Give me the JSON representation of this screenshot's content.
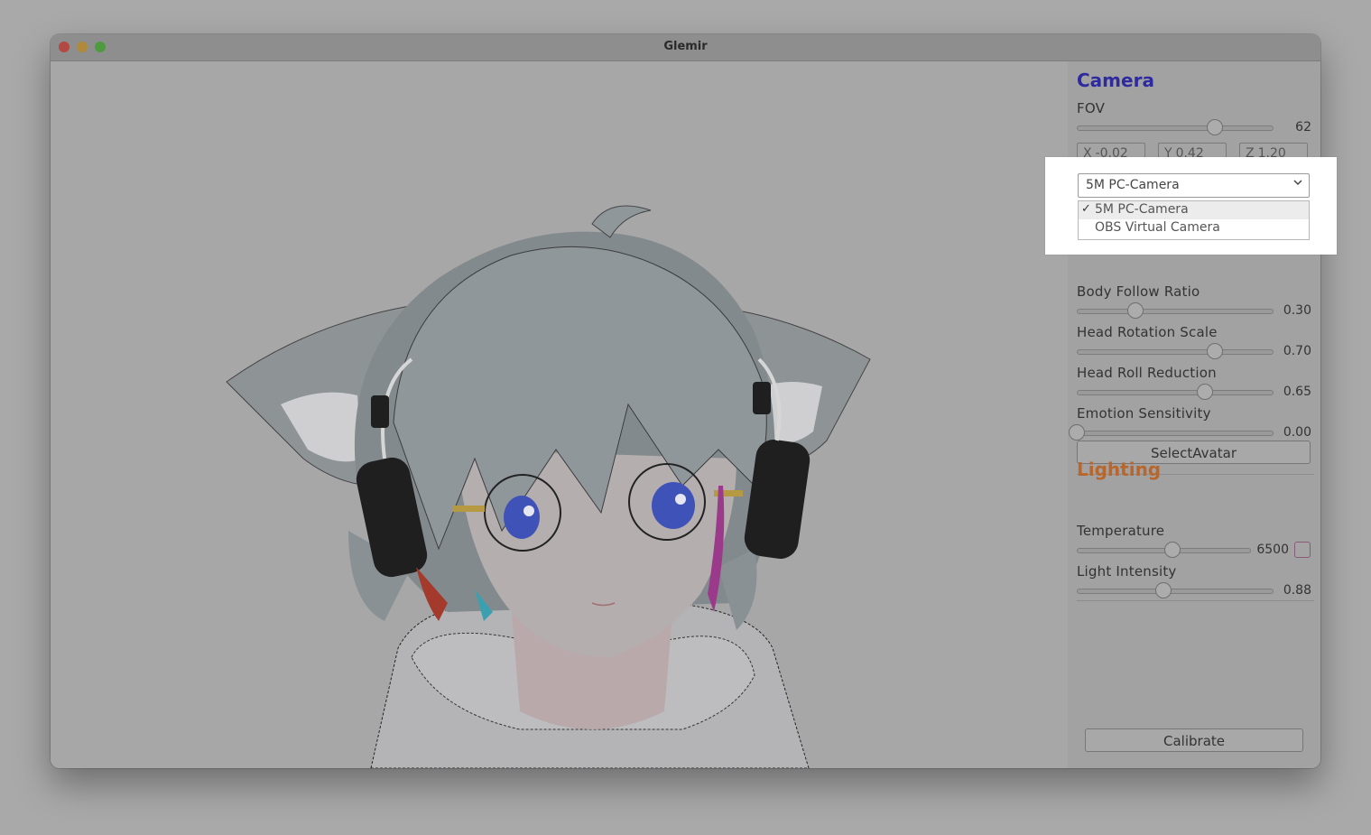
{
  "window": {
    "title": "Glemir"
  },
  "camera": {
    "title": "Camera",
    "fov": {
      "label": "FOV",
      "value": "62",
      "fraction": 0.7
    },
    "position": {
      "x": {
        "axis": "X",
        "value": "-0.02"
      },
      "y": {
        "axis": "Y",
        "value": "0.42"
      },
      "z": {
        "axis": "Z",
        "value": "1.20"
      }
    },
    "device_select": {
      "selected": "5M PC-Camera",
      "options": [
        "5M PC-Camera",
        "OBS Virtual Camera"
      ],
      "check_glyph": "✓"
    },
    "body_follow_ratio": {
      "label": "Body Follow Ratio",
      "value": "0.30",
      "fraction": 0.3
    },
    "head_rotation_scale": {
      "label": "Head Rotation Scale",
      "value": "0.70",
      "fraction": 0.7
    },
    "head_roll_reduction": {
      "label": "Head Roll Reduction",
      "value": "0.65",
      "fraction": 0.65
    },
    "emotion_sensitivity": {
      "label": "Emotion Sensitivity",
      "value": "0.00",
      "fraction": 0.0
    },
    "select_avatar_label": "SelectAvatar"
  },
  "lighting": {
    "title": "Lighting",
    "temperature": {
      "label": "Temperature",
      "value": "6500",
      "fraction": 0.55
    },
    "light_intensity": {
      "label": "Light Intensity",
      "value": "0.88",
      "fraction": 0.44
    }
  },
  "calibrate_label": "Calibrate",
  "colors": {
    "camera_title": "#2e2ba0",
    "lighting_title": "#b8662b",
    "highlight": "#ffffff"
  },
  "icons": {
    "dropdown": "chevron-down-icon",
    "selected": "checkmark-icon"
  }
}
